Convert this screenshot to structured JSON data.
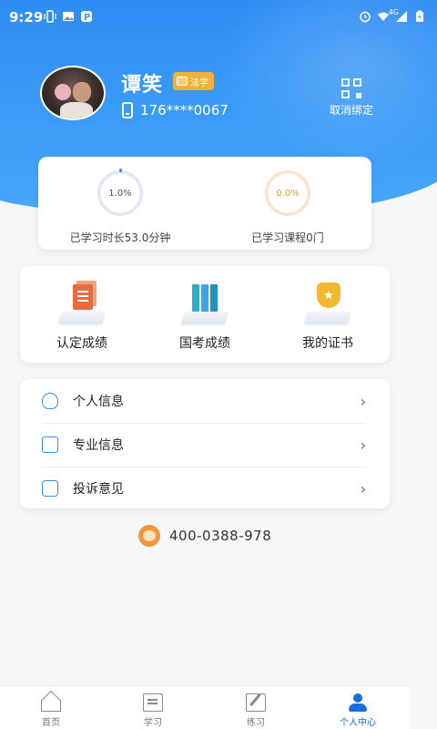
{
  "status_bar": {
    "time": "9:29",
    "network": "4G"
  },
  "profile": {
    "name": "谭笑",
    "tag": "法学",
    "phone": "176****0067",
    "unbind_label": "取消绑定"
  },
  "stats": [
    {
      "percent": "1.0%",
      "label": "已学习时长53.0分钟"
    },
    {
      "percent": "0.0%",
      "label": "已学习课程0门"
    }
  ],
  "features": [
    {
      "label": "认定成绩",
      "icon": "document-icon"
    },
    {
      "label": "国考成绩",
      "icon": "books-icon"
    },
    {
      "label": "我的证书",
      "icon": "certificate-icon"
    }
  ],
  "menu": [
    {
      "label": "个人信息",
      "icon": "user-info-icon"
    },
    {
      "label": "专业信息",
      "icon": "folder-icon"
    },
    {
      "label": "投诉意见",
      "icon": "feedback-icon"
    }
  ],
  "hotline": "400-0388-978",
  "tabbar": [
    {
      "label": "首页",
      "active": false
    },
    {
      "label": "学习",
      "active": false
    },
    {
      "label": "练习",
      "active": false
    },
    {
      "label": "个人中心",
      "active": true
    }
  ],
  "colors": {
    "primary": "#2f8cf4",
    "active_tab": "#1a6fe0",
    "tag": "#f0b23a"
  }
}
